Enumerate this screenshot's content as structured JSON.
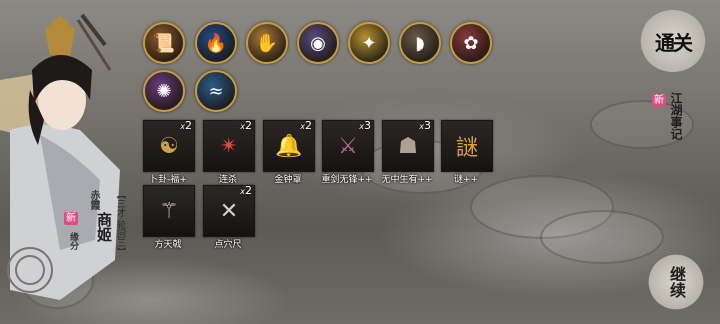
{
  "colors": {
    "accent_gold": "#c79a3c",
    "new_badge": "#d84f86",
    "background": "#726f69"
  },
  "character": {
    "title_line": "【三才·轮回三】",
    "name": "商姬",
    "prefix": "赤霞",
    "new_badge": "新",
    "footer": "缘分"
  },
  "equipment_orbs": [
    {
      "icon": "scroll-armor-icon",
      "glyph": "📜",
      "color": "#8b5a2b"
    },
    {
      "icon": "blue-flame-icon",
      "glyph": "🔥",
      "color": "#1e4a8a"
    },
    {
      "icon": "gauntlet-icon",
      "glyph": "✋",
      "color": "#a87a3a"
    },
    {
      "icon": "pearl-icon",
      "glyph": "◉",
      "color": "#5a4a7a"
    },
    {
      "icon": "golden-feather-icon",
      "glyph": "✦",
      "color": "#b8912e"
    },
    {
      "icon": "horn-icon",
      "glyph": "◗",
      "color": "#6a5a4a"
    },
    {
      "icon": "red-flower-icon",
      "glyph": "✿",
      "color": "#8a3a3a"
    },
    {
      "icon": "purple-talisman-icon",
      "glyph": "✺",
      "color": "#6a3a7a"
    },
    {
      "icon": "blue-wave-icon",
      "glyph": "≈",
      "color": "#2a5a8a"
    }
  ],
  "skills": [
    {
      "icon": "divination-icon",
      "glyph": "☯",
      "count": "2",
      "label": "卜卦-福+",
      "color": "#d0a24a"
    },
    {
      "icon": "slash-icon",
      "glyph": "✴",
      "count": "2",
      "label": "连杀",
      "color": "#e04a3a"
    },
    {
      "icon": "golden-bell-icon",
      "glyph": "🔔",
      "count": "2",
      "label": "金钟罩",
      "color": "#c8953a"
    },
    {
      "icon": "heavy-sword-icon",
      "glyph": "⚔",
      "count": "3",
      "label": "重剑无锋++",
      "color": "#b86aa0"
    },
    {
      "icon": "phantom-icon",
      "glyph": "☗",
      "count": "3",
      "label": "无中生有++",
      "color": "#b0a090"
    },
    {
      "icon": "riddle-icon",
      "glyph": "謎",
      "count": "",
      "label": "谜++",
      "color": "#e0a030"
    },
    {
      "icon": "halberd-icon",
      "glyph": "⚚",
      "count": "",
      "label": "方天戟",
      "color": "#c8c0b0"
    },
    {
      "icon": "acupoint-ruler-icon",
      "glyph": "✕",
      "count": "2",
      "label": "点穴尺",
      "color": "#d0d0d0"
    }
  ],
  "buttons": {
    "map_label": "通关",
    "events_label": "江湖事记",
    "events_badge": "新",
    "continue_label": "继续"
  }
}
